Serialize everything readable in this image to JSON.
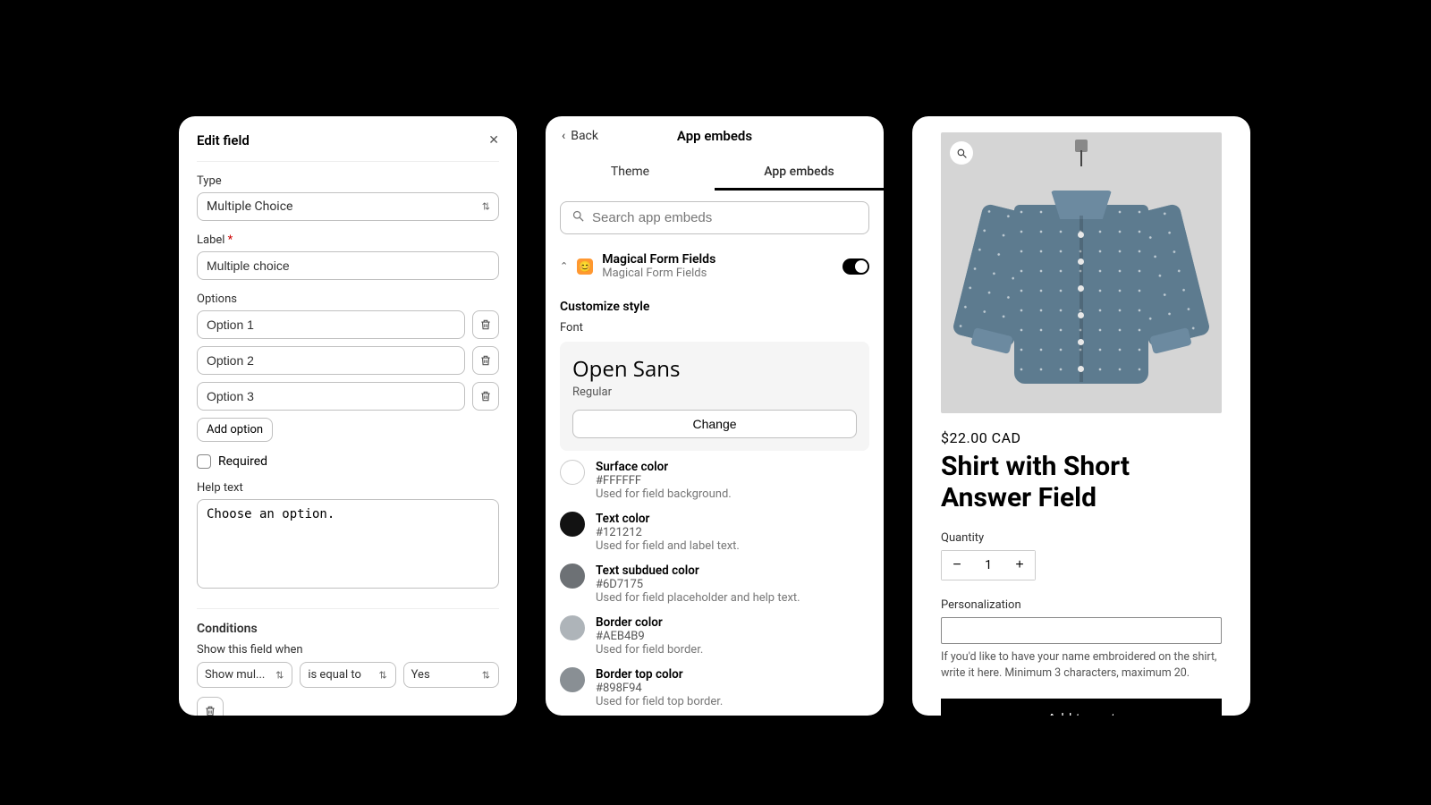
{
  "editField": {
    "title": "Edit field",
    "typeLabel": "Type",
    "typeValue": "Multiple Choice",
    "labelLabel": "Label",
    "labelValue": "Multiple choice",
    "optionsLabel": "Options",
    "options": [
      "Option 1",
      "Option 2",
      "Option 3"
    ],
    "addOption": "Add option",
    "requiredLabel": "Required",
    "helpTextLabel": "Help text",
    "helpTextValue": "Choose an option.",
    "conditionsTitle": "Conditions",
    "conditionsHint": "Show this field when",
    "condField": "Show mul...",
    "condOp": "is equal to",
    "condVal": "Yes"
  },
  "embeds": {
    "back": "Back",
    "title": "App embeds",
    "tabTheme": "Theme",
    "tabEmbeds": "App embeds",
    "searchPlaceholder": "Search app embeds",
    "appName": "Magical Form Fields",
    "appSub": "Magical Form Fields",
    "customizeTitle": "Customize style",
    "fontLabel": "Font",
    "fontName": "Open Sans",
    "fontStyle": "Regular",
    "changeLabel": "Change",
    "colors": [
      {
        "name": "Surface color",
        "hex": "#FFFFFF",
        "desc": "Used for field background."
      },
      {
        "name": "Text color",
        "hex": "#121212",
        "desc": "Used for field and label text."
      },
      {
        "name": "Text subdued color",
        "hex": "#6D7175",
        "desc": "Used for field placeholder and help text."
      },
      {
        "name": "Border color",
        "hex": "#AEB4B9",
        "desc": "Used for field border."
      },
      {
        "name": "Border top color",
        "hex": "#898F94",
        "desc": "Used for field top border."
      }
    ]
  },
  "product": {
    "price": "$22.00 CAD",
    "title": "Shirt with Short Answer Field",
    "qtyLabel": "Quantity",
    "qtyValue": "1",
    "persLabel": "Personalization",
    "persHelp": "If you'd like to have your name embroidered on the shirt, write it here. Minimum 3 characters, maximum 20.",
    "addToCart": "Add to cart"
  }
}
